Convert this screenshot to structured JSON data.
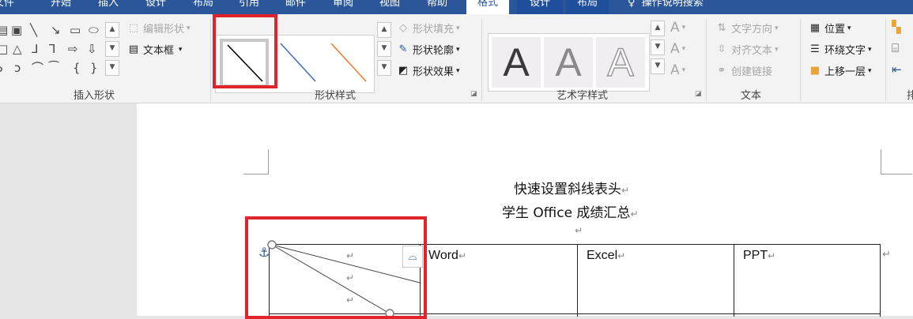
{
  "tabs": [
    {
      "label": "文件"
    },
    {
      "label": "开始"
    },
    {
      "label": "插入"
    },
    {
      "label": "设计"
    },
    {
      "label": "布局"
    },
    {
      "label": "引用"
    },
    {
      "label": "邮件"
    },
    {
      "label": "审阅"
    },
    {
      "label": "视图"
    },
    {
      "label": "帮助"
    },
    {
      "label": "格式"
    },
    {
      "label": "设计"
    },
    {
      "label": "布局"
    },
    {
      "label": "操作说明搜索"
    }
  ],
  "groups": {
    "insert_shapes": {
      "label": "插入形状",
      "edit_shape": "编辑形状",
      "text_box": "文本框"
    },
    "shape_styles": {
      "label": "形状样式",
      "fill": "形状填充",
      "outline": "形状轮廓",
      "effects": "形状效果"
    },
    "wordart": {
      "label": "艺术字样式",
      "letter": "A"
    },
    "text": {
      "label": "文本",
      "direction": "文字方向",
      "align": "对齐文本",
      "link": "创建链接"
    },
    "arrange": {
      "label": "排列",
      "position": "位置",
      "wrap": "环绕文字",
      "forward": "上移一层"
    }
  },
  "document": {
    "title_line1": "快速设置斜线表头",
    "title_line2": "学生 Office 成绩汇总",
    "para_mark": "↵",
    "headers": [
      "Word",
      "Excel",
      "PPT"
    ]
  },
  "colors": {
    "accent": "#2b579a",
    "highlight": "#e0242c",
    "line_blue": "#4472c4",
    "line_orange": "#ed7d31"
  }
}
